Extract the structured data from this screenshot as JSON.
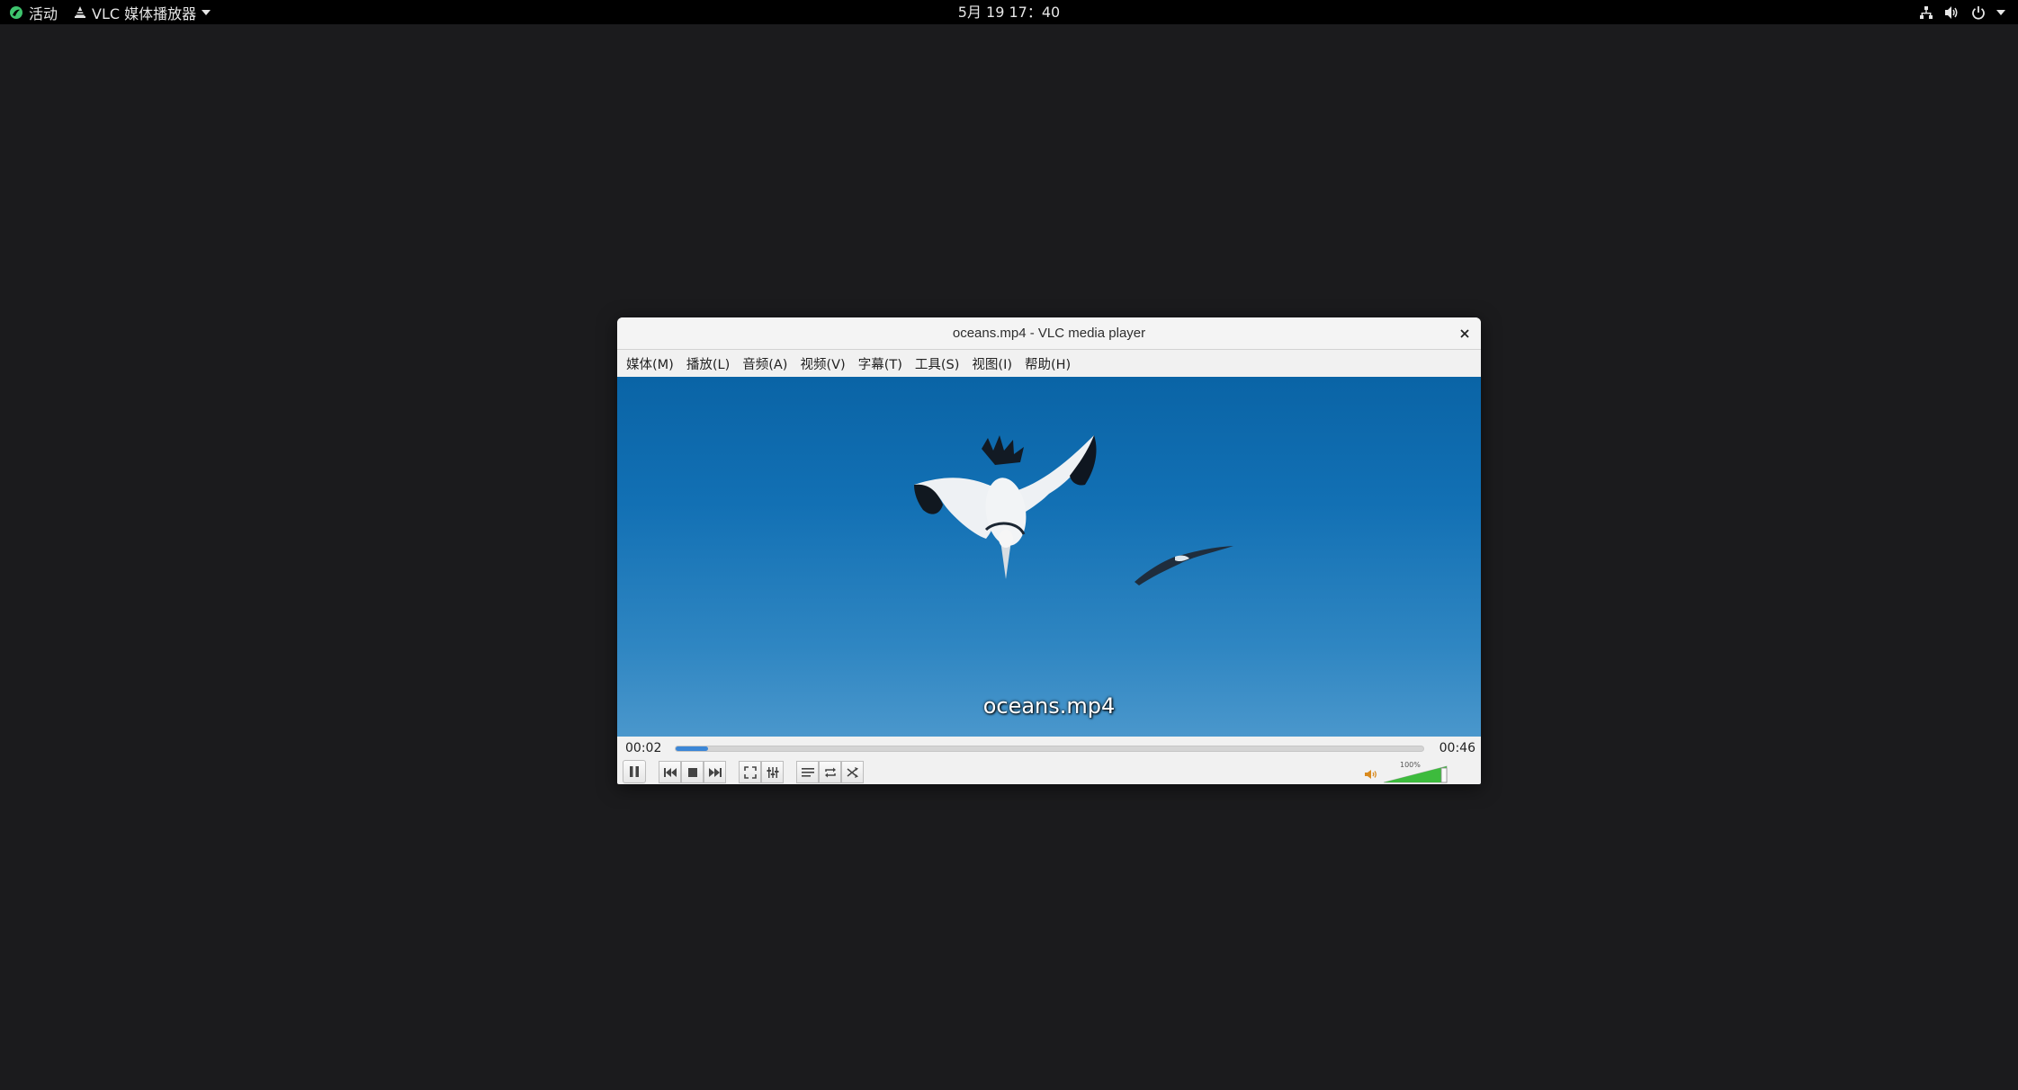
{
  "topbar": {
    "activities_label": "活动",
    "app_menu_label": "VLC 媒体播放器",
    "clock": "5月 19  17：40",
    "icons": [
      "network-icon",
      "volume-icon",
      "power-icon",
      "chevron-down-icon"
    ]
  },
  "window": {
    "title": "oceans.mp4 - VLC media player",
    "close_glyph": "×"
  },
  "menubar": {
    "items": [
      {
        "label": "媒体(M)"
      },
      {
        "label": "播放(L)"
      },
      {
        "label": "音频(A)"
      },
      {
        "label": "视频(V)"
      },
      {
        "label": "字幕(T)"
      },
      {
        "label": "工具(S)"
      },
      {
        "label": "视图(I)"
      },
      {
        "label": "帮助(H)"
      }
    ]
  },
  "video": {
    "subtitle": "oceans.mp4"
  },
  "playback": {
    "elapsed": "00:02",
    "total": "00:46",
    "progress_fraction": 0.043
  },
  "controls": {
    "buttons": [
      "pause-icon",
      "previous-icon",
      "stop-icon",
      "next-icon",
      "fullscreen-icon",
      "extended-settings-icon",
      "playlist-icon",
      "loop-icon",
      "shuffle-icon"
    ]
  },
  "volume": {
    "label": "100%",
    "level_fraction": 1.0
  },
  "colors": {
    "video_sky": "#1270b4",
    "seek_fill": "#3b86d6",
    "volume_fill": "#3dbb3d"
  }
}
